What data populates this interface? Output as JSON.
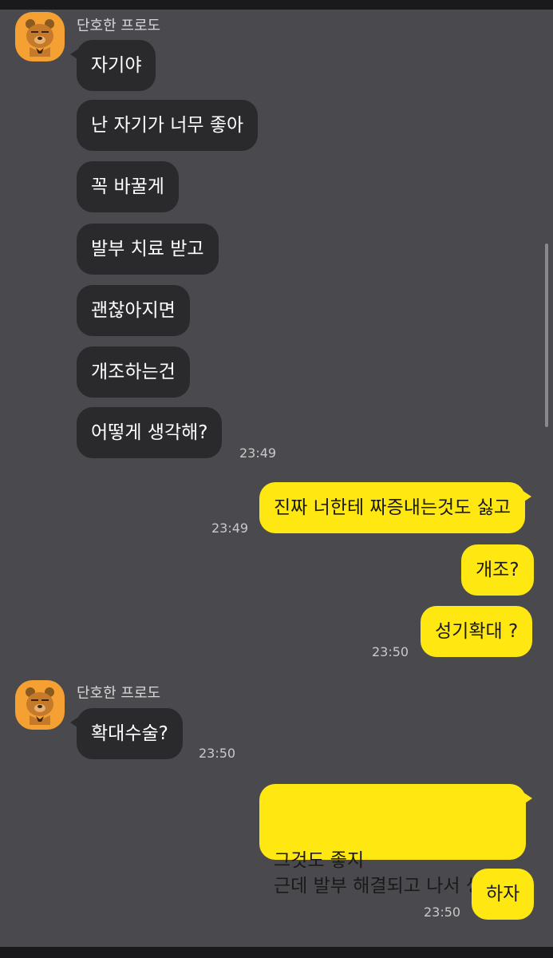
{
  "sender_name": "단호한 프로도",
  "avatar_icon": "bear-avatar-icon",
  "colors": {
    "background": "#4a4a4e",
    "incoming_bubble": "#2a2a2c",
    "outgoing_bubble": "#ffe812",
    "avatar": "#f5a033"
  },
  "messages": [
    {
      "from": "them",
      "text": "자기야"
    },
    {
      "from": "them",
      "text": "난 자기가 너무 좋아"
    },
    {
      "from": "them",
      "text": "꼭 바꿀게"
    },
    {
      "from": "them",
      "text": "발부 치료 받고"
    },
    {
      "from": "them",
      "text": "괜찮아지면"
    },
    {
      "from": "them",
      "text": "개조하는건"
    },
    {
      "from": "them",
      "text": "어떻게 생각해?",
      "time": "23:49"
    },
    {
      "from": "me",
      "text": "진짜 너한테 짜증내는것도 싫고",
      "time": "23:49"
    },
    {
      "from": "me",
      "text": "개조?"
    },
    {
      "from": "me",
      "text": "성기확대 ?",
      "time": "23:50"
    },
    {
      "from": "them",
      "text": "확대수술?",
      "time": "23:50"
    },
    {
      "from": "me",
      "text": "그것도 좋지\n근데 발부 해결되고 나서 생각..",
      "time": ""
    },
    {
      "from": "me",
      "text": "하자",
      "time": "23:50"
    }
  ]
}
